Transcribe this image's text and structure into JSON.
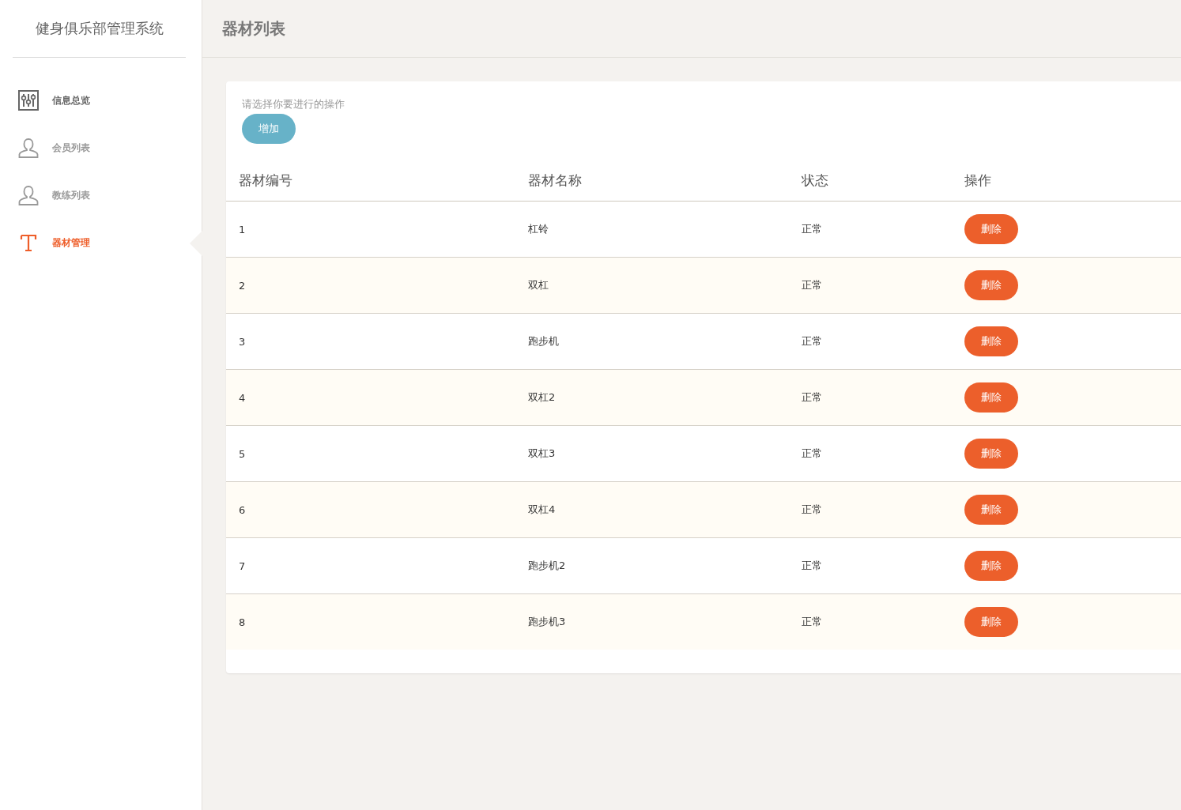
{
  "sidebar": {
    "title": "健身俱乐部管理系统",
    "items": [
      {
        "label": "信息总览",
        "kind": "sliders",
        "selected": false,
        "emphasized": true
      },
      {
        "label": "会员列表",
        "kind": "person",
        "selected": false,
        "emphasized": false
      },
      {
        "label": "教练列表",
        "kind": "person",
        "selected": false,
        "emphasized": false
      },
      {
        "label": "器材管理",
        "kind": "letter",
        "selected": true,
        "emphasized": false
      }
    ]
  },
  "header": {
    "title": "器材列表"
  },
  "panel": {
    "prompt": "请选择你要进行的操作",
    "add_button": "增加"
  },
  "table": {
    "columns": [
      "器材编号",
      "器材名称",
      "状态",
      "操作"
    ],
    "rows": [
      {
        "id": "1",
        "name": "杠铃",
        "status": "正常",
        "action": "删除"
      },
      {
        "id": "2",
        "name": "双杠",
        "status": "正常",
        "action": "删除"
      },
      {
        "id": "3",
        "name": "跑步机",
        "status": "正常",
        "action": "删除"
      },
      {
        "id": "4",
        "name": "双杠2",
        "status": "正常",
        "action": "删除"
      },
      {
        "id": "5",
        "name": "双杠3",
        "status": "正常",
        "action": "删除"
      },
      {
        "id": "6",
        "name": "双杠4",
        "status": "正常",
        "action": "删除"
      },
      {
        "id": "7",
        "name": "跑步机2",
        "status": "正常",
        "action": "删除"
      },
      {
        "id": "8",
        "name": "跑步机3",
        "status": "正常",
        "action": "删除"
      }
    ]
  }
}
